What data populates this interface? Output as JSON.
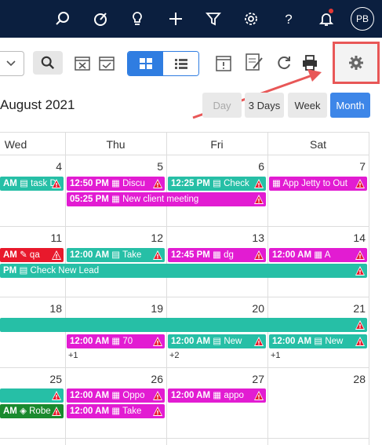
{
  "header": {
    "avatar_initials": "PB",
    "icons": [
      "search-icon",
      "explore-icon",
      "lightbulb-icon",
      "plus-icon",
      "filter-icon",
      "gear-icon",
      "help-icon",
      "bell-icon"
    ]
  },
  "toolbar": {
    "icons": [
      "search-icon",
      "calendar-cancel-icon",
      "calendar-check-icon",
      "grid-view-icon",
      "list-view-icon",
      "calendar-alert-icon",
      "edit-note-icon",
      "refresh-icon",
      "print-icon",
      "settings-gear-icon"
    ],
    "highlight_color": "#e85757"
  },
  "calendar": {
    "month_title": "August 2021",
    "views": [
      "Day",
      "3 Days",
      "Week",
      "Month"
    ],
    "active_view": "Month",
    "day_headers": [
      "Wed",
      "Thu",
      "Fri",
      "Sat"
    ],
    "weeks": [
      {
        "days": [
          "4",
          "5",
          "6",
          "7"
        ]
      },
      {
        "days": [
          "11",
          "12",
          "13",
          "14"
        ]
      },
      {
        "days": [
          "18",
          "19",
          "20",
          "21"
        ]
      },
      {
        "days": [
          "25",
          "26",
          "27",
          "28"
        ]
      }
    ],
    "events": {
      "w1_wed": {
        "time": "AM",
        "title": "task D"
      },
      "w1_thu_1": {
        "time": "12:50 PM",
        "title": "Discu"
      },
      "w1_thu_2": {
        "time": "05:25 PM",
        "title": "New client meeting"
      },
      "w1_fri": {
        "time": "12:25 PM",
        "title": "Check"
      },
      "w1_sat": {
        "time": "",
        "title": "App Jetty to Out"
      },
      "w2_wed": {
        "time": "AM",
        "title": "qa"
      },
      "w2_thu": {
        "time": "12:00 AM",
        "title": "Take"
      },
      "w2_fri": {
        "time": "12:45 PM",
        "title": "dg"
      },
      "w2_sat": {
        "time": "12:00 AM",
        "title": "A"
      },
      "w2_span": {
        "time": "PM",
        "title": "Check New Lead"
      },
      "w3_thu": {
        "time": "12:00 AM",
        "title": "70"
      },
      "w3_fri": {
        "time": "12:00 AM",
        "title": "New"
      },
      "w3_sat": {
        "time": "12:00 AM",
        "title": "New"
      },
      "w3_more_thu": "+1",
      "w3_more_fri": "+2",
      "w3_more_sat": "+1",
      "w4_thu_1": {
        "time": "12:00 AM",
        "title": "Oppo"
      },
      "w4_thu_2": {
        "time": "12:00 AM",
        "title": "Take"
      },
      "w4_fri": {
        "time": "12:00 AM",
        "title": "appo"
      },
      "w4_wed_2": {
        "time": "AM",
        "title": "Robe"
      }
    }
  },
  "colors": {
    "topbar": "#0b1f3f",
    "teal": "#26bfa6",
    "magenta": "#e21cd2",
    "red": "#e8192c",
    "green": "#1a8a2e",
    "active_view": "#3d86e8"
  }
}
